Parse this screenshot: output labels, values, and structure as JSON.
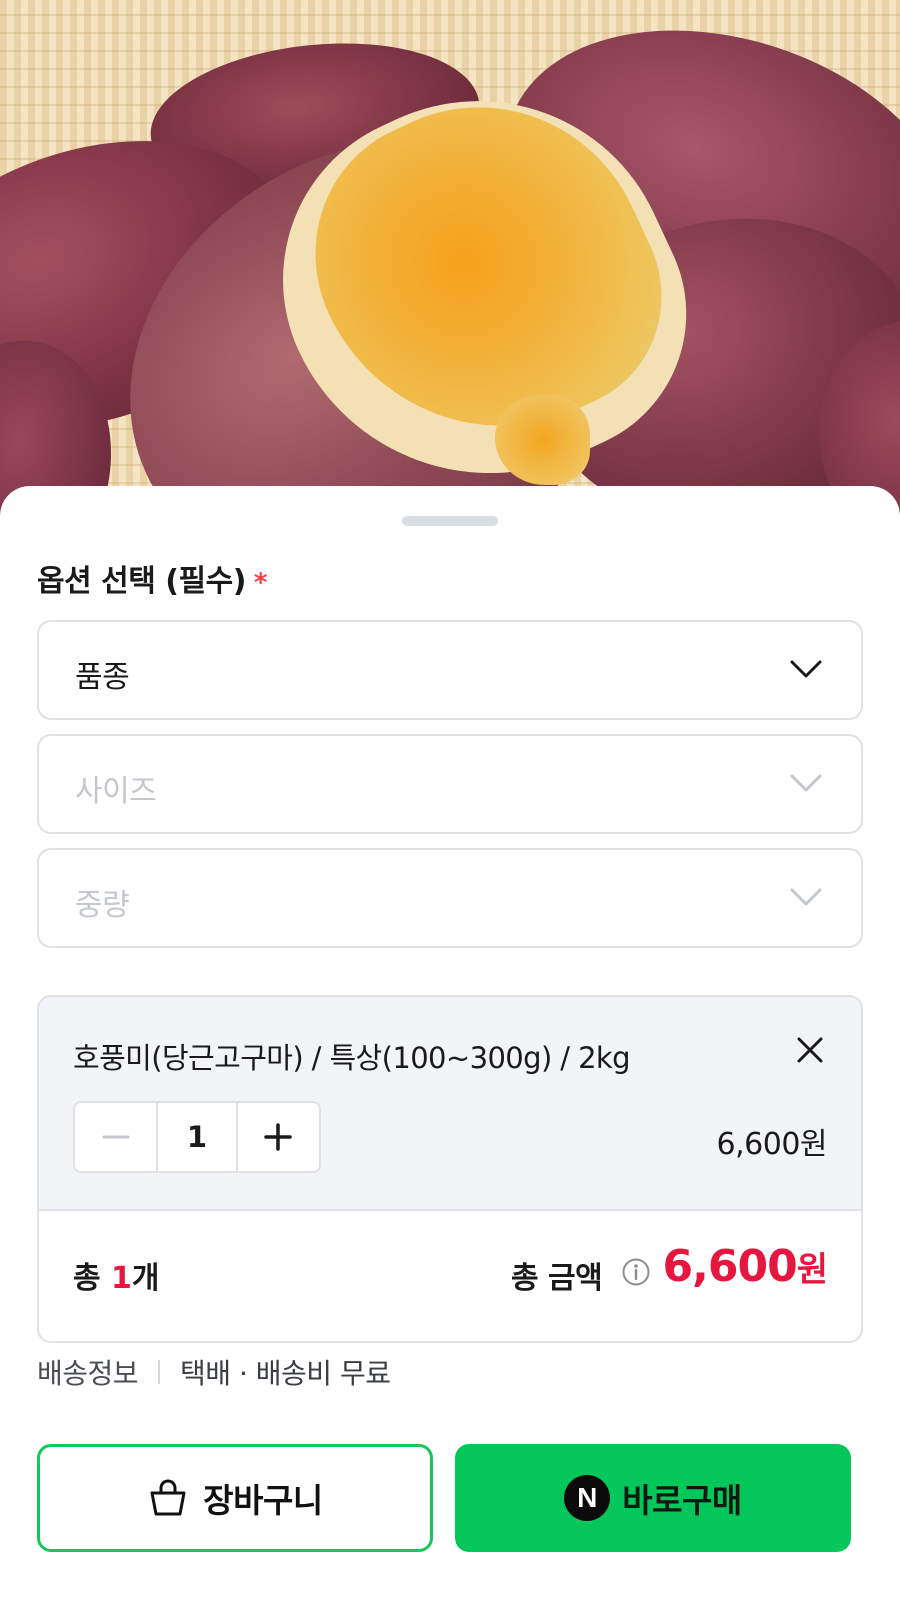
{
  "options": {
    "section_title": "옵션 선택 (필수)",
    "required_mark": "*",
    "selects": [
      {
        "label": "품종",
        "enabled": true
      },
      {
        "label": "사이즈",
        "enabled": false
      },
      {
        "label": "중량",
        "enabled": false
      }
    ]
  },
  "selected_item": {
    "name": "호풍미(당근고구마) / 특상(100~300g) / 2kg",
    "quantity": "1",
    "price": "6,600원"
  },
  "summary": {
    "count_prefix": "총 ",
    "count_value": "1",
    "count_suffix": "개",
    "total_label": "총 금액",
    "total_value": "6,600",
    "total_unit": "원"
  },
  "delivery": {
    "label": "배송정보",
    "value": "택배 · 배송비 무료"
  },
  "buttons": {
    "cart_label": "장바구니",
    "buy_label": "바로구매",
    "npay_mark": "N"
  },
  "icons": {
    "select_chevron": "chevron-down-icon",
    "remove": "close-icon",
    "info": "info-icon",
    "cart": "shopping-bag-icon",
    "npay": "naver-pay-icon"
  },
  "colors": {
    "accent_red": "#e5173f",
    "brand_green": "#03c75a",
    "border": "#dfe1e5",
    "panel_bg": "#f2f4f8"
  }
}
